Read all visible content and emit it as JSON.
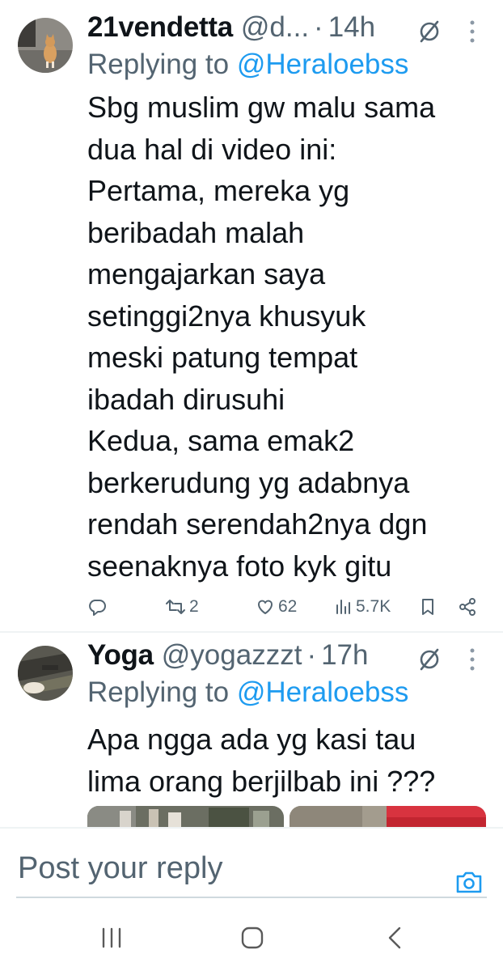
{
  "tweets": [
    {
      "display_name": "21vendetta",
      "handle": "@d...",
      "separator": "·",
      "time": "14h",
      "replying_prefix": "Replying to ",
      "replying_to": "@Heraloebss",
      "text_lines": [
        "Sbg muslim gw malu sama",
        "dua hal di video ini:",
        "Pertama, mereka yg",
        "beribadah malah",
        "mengajarkan saya",
        "setinggi2nya khusyuk",
        "meski patung tempat",
        "ibadah dirusuhi",
        "Kedua, sama emak2",
        "berkerudung yg adabnya",
        "rendah serendah2nya dgn",
        "seenaknya foto kyk gitu"
      ],
      "actions": {
        "retweets": "2",
        "likes": "62",
        "views": "5.7K"
      }
    },
    {
      "display_name": "Yoga",
      "handle": "@yogazzzt",
      "separator": "·",
      "time": "17h",
      "replying_prefix": "Replying to ",
      "replying_to": "@Heraloebss",
      "text_lines": [
        "Apa ngga ada yg kasi tau",
        "lima orang berjilbab ini ???"
      ]
    }
  ],
  "reply_bar": {
    "placeholder": "Post your reply"
  },
  "icons": {
    "reply": "reply-icon",
    "retweet": "retweet-icon",
    "like": "heart-icon",
    "views": "views-icon",
    "bookmark": "bookmark-icon",
    "share": "share-icon",
    "grok": "grok-icon",
    "more": "more-options-icon",
    "camera": "camera-icon",
    "nav_recents": "recent-apps-icon",
    "nav_home": "home-icon",
    "nav_back": "back-icon"
  },
  "colors": {
    "accent": "#1d9bf0",
    "secondary_text": "#536471",
    "primary_text": "#0f1419"
  }
}
